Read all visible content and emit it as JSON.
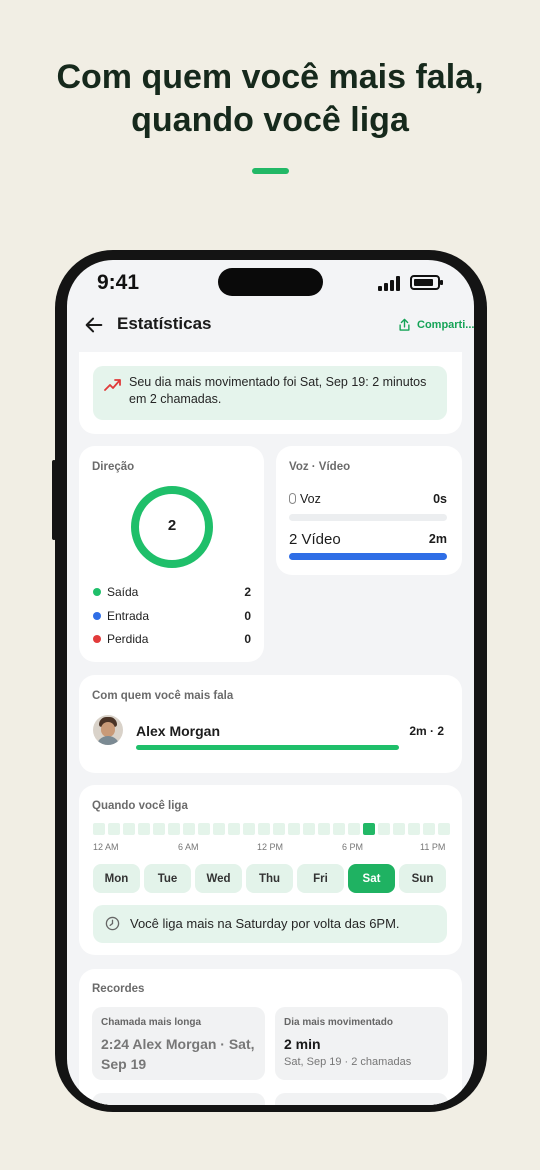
{
  "headline": {
    "line1": "Com quem você mais fala,",
    "line2": "quando você liga"
  },
  "colors": {
    "accent": "#22b866",
    "outgoing": "#1fbf6a",
    "incoming": "#2f6ee6",
    "missed": "#e23b3b",
    "video_bar": "#2f6ee6",
    "background": "#f1eee4"
  },
  "status_bar": {
    "time": "9:41",
    "signal_icon": "signal-icon",
    "battery_icon": "battery-icon"
  },
  "app_bar": {
    "back_icon": "arrow-left-icon",
    "title": "Estatísticas",
    "share_icon": "share-icon",
    "share_label": "Comparti..."
  },
  "insight": {
    "icon": "trending-up-icon",
    "text": "Seu dia mais movimentado foi Sat, Sep 19: 2 minutos em 2 chamadas."
  },
  "direction": {
    "title": "Direção",
    "total": "2",
    "legend": [
      {
        "label": "Saída",
        "value": "2"
      },
      {
        "label": "Entrada",
        "value": "0"
      },
      {
        "label": "Perdida",
        "value": "0"
      }
    ]
  },
  "voice_video": {
    "title": "Voz · Vídeo",
    "voice": {
      "icon": "microphone-icon",
      "label": "Voz",
      "value": "0s",
      "fraction": 0
    },
    "video": {
      "label": "2 Vídeo",
      "value": "2m",
      "fraction": 1
    }
  },
  "top_contact": {
    "title": "Com quem você mais fala",
    "name": "Alex Morgan",
    "stats": "2m · 2",
    "fraction": 1
  },
  "when_you_call": {
    "title": "Quando você liga",
    "hot_hour": 18,
    "hour_labels": [
      "12 AM",
      "6 AM",
      "12 PM",
      "6 PM",
      "11 PM"
    ],
    "days": [
      "Mon",
      "Tue",
      "Wed",
      "Thu",
      "Fri",
      "Sat",
      "Sun"
    ],
    "active_day": "Sat",
    "tip_icon": "clock-icon",
    "tip": "Você liga mais na Saturday por volta das 6PM."
  },
  "records": {
    "title": "Recordes",
    "longest": {
      "label": "Chamada mais longa",
      "value": "2:24 Alex Morgan · Sat, Sep 19"
    },
    "busiest": {
      "label": "Dia mais movimentado",
      "value": "2 min",
      "sub": "Sat, Sep 19 · 2 chamadas"
    }
  }
}
